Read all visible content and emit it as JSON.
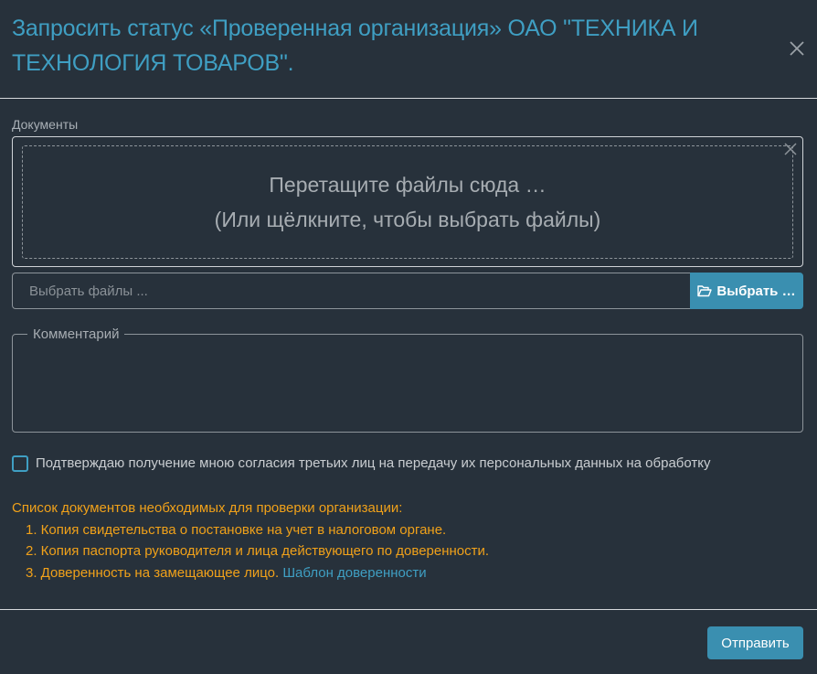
{
  "header": {
    "title": "Запросить статус «Проверенная организация» ОАО \"ТЕХНИКА И ТЕХНОЛОГИЯ ТОВАРОВ\"."
  },
  "documents": {
    "label": "Документы",
    "drop_line1": "Перетащите файлы сюда …",
    "drop_line2": "(Или щёлкните, чтобы выбрать файлы)",
    "file_placeholder": "Выбрать файлы ...",
    "browse_label": "Выбрать …"
  },
  "comment": {
    "legend": "Комментарий",
    "value": ""
  },
  "consent": {
    "checked": false,
    "label": "Подтверждаю получение мною согласия третьих лиц на передачу их персональных данных на обработку"
  },
  "doc_list": {
    "heading": "Список документов необходимых для проверки организации:",
    "items": [
      "1. Копия свидетельства о постановке на учет в налоговом органе.",
      "2. Копия паспорта руководителя и лица действующего по доверенности.",
      "3. Доверенность на замещающее лицо."
    ],
    "template_link": "Шаблон доверенности"
  },
  "footer": {
    "submit_label": "Отправить"
  },
  "icons": {
    "close": "close-icon",
    "drop_clear": "close-icon",
    "folder": "folder-open-icon"
  },
  "colors": {
    "background": "#27313b",
    "accent": "#3f9fc3",
    "button": "#3a8fb0",
    "warning_text": "#f0a11a"
  }
}
